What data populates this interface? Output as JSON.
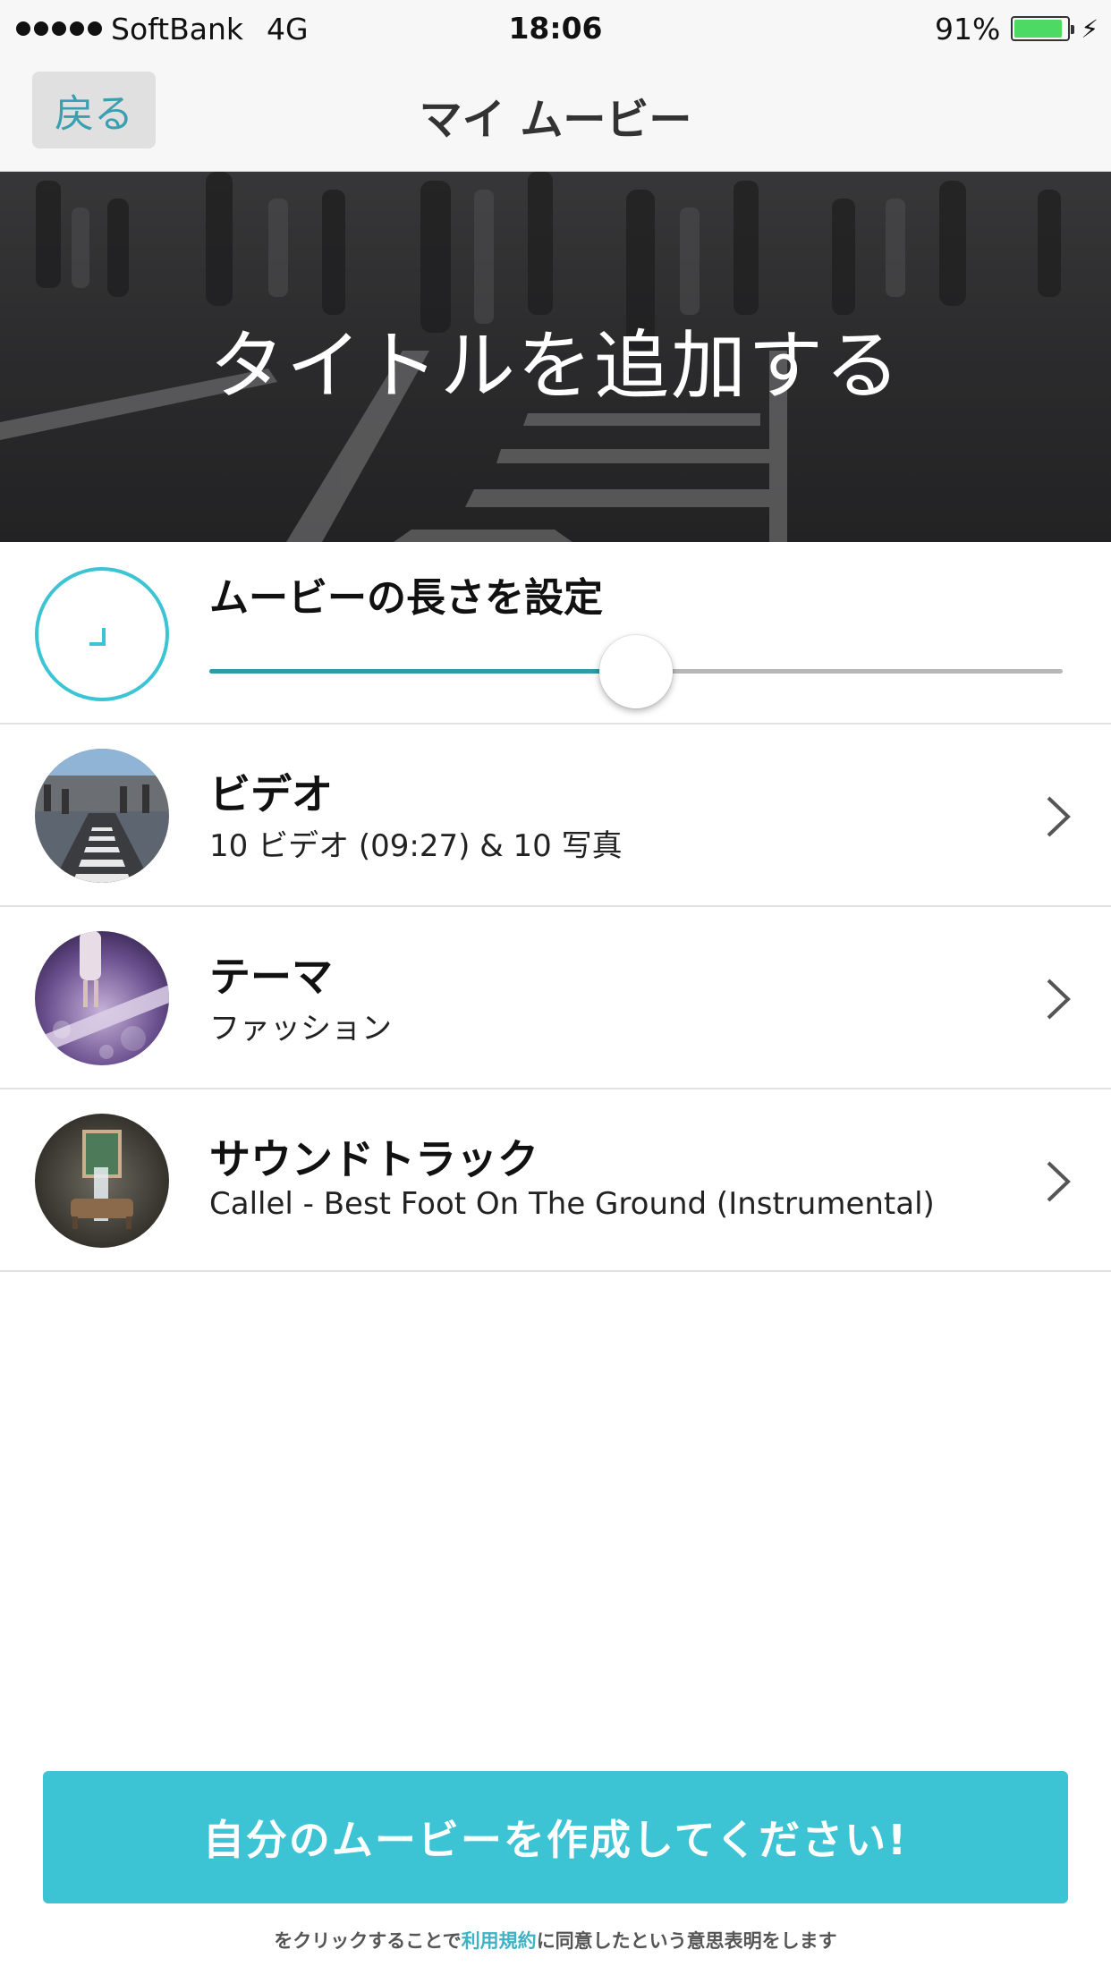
{
  "status_bar": {
    "carrier": "SoftBank",
    "network": "4G",
    "time": "18:06",
    "battery": "91%",
    "battery_level": 0.91,
    "battery_color": "#4cd964"
  },
  "nav": {
    "back_label": "戻る",
    "title": "マイ ムービー"
  },
  "hero": {
    "title": "タイトルを追加する"
  },
  "length": {
    "label": "ムービーの長さを設定",
    "slider_value": 0.5,
    "accent": "#3cc4d4",
    "icon": "clock-icon"
  },
  "rows": [
    {
      "title": "ビデオ",
      "subtitle": "10 ビデオ (09:27) & 10 写真",
      "icon": "chevron-right-icon"
    },
    {
      "title": "テーマ",
      "subtitle": "ファッション",
      "icon": "chevron-right-icon"
    },
    {
      "title": "サウンドトラック",
      "subtitle": "Callel - Best Foot On The Ground (Instrumental)",
      "icon": "chevron-right-icon"
    }
  ],
  "create_button": {
    "label": "自分のムービーを作成してください!",
    "color": "#3cc4d4"
  },
  "terms": {
    "before": "をクリックすることで",
    "link": "利用規約",
    "after": "に同意したという意思表明をします"
  }
}
